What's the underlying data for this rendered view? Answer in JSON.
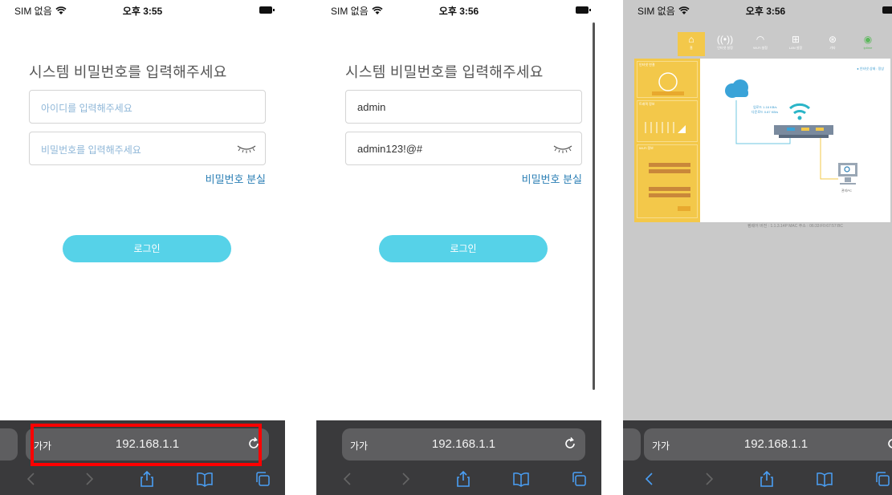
{
  "screens": [
    {
      "status": {
        "carrier": "SIM 없음",
        "time": "오후 3:55"
      },
      "login": {
        "title": "시스템 비밀번호를 입력해주세요",
        "id_placeholder": "아이디를 입력해주세요",
        "id_value": "",
        "pw_placeholder": "비밀번호를 입력해주세요",
        "pw_value": "",
        "forgot_label": "비밀번호 분실",
        "login_label": "로그인"
      },
      "browser": {
        "aa": "가가",
        "url": "192.168.1.1",
        "highlighted": true
      }
    },
    {
      "status": {
        "carrier": "SIM 없음",
        "time": "오후 3:56"
      },
      "login": {
        "title": "시스템 비밀번호를 입력해주세요",
        "id_placeholder": "아이디를 입력해주세요",
        "id_value": "admin",
        "pw_placeholder": "비밀번호를 입력해주세요",
        "pw_value": "admin123!@#",
        "forgot_label": "비밀번호 분실",
        "login_label": "로그인"
      },
      "browser": {
        "aa": "가가",
        "url": "192.168.1.1",
        "highlighted": false
      }
    },
    {
      "status": {
        "carrier": "SIM 없음",
        "time": "오후 3:56"
      },
      "dashboard": {
        "connection_status": "● 인터넷 상태 : 정상",
        "firmware": "펌웨어 버전 : 1.1.3.14P    MAC 주소 : 06:33:F0:67:57:BC",
        "nav": [
          "홈",
          "인터넷 설정",
          "Wi-Fi 설정",
          "LAN 설정",
          "기타",
          "iptime"
        ],
        "side_headers": [
          "인터넷 연결",
          "트래픽 정보",
          "Wi-Fi 정보"
        ],
        "up_speed": "업로드 1.16 KB/s",
        "down_speed": "다운로드 0.87 KB/s",
        "pc_label": "관리PC"
      },
      "browser": {
        "aa": "가가",
        "url": "192.168.1.1",
        "highlighted": false
      }
    }
  ],
  "colors": {
    "accent": "#56d2e8",
    "link": "#2b7fb5",
    "placeholder": "#8fb7d8",
    "toolbar": "#3a3a3c",
    "highlight": "#ff0000",
    "router_yellow": "#f3c84a"
  },
  "icons": [
    "wifi-icon",
    "battery-icon",
    "eye-closed-icon",
    "reload-icon",
    "back-icon",
    "forward-icon",
    "share-icon",
    "bookmarks-icon",
    "tabs-icon"
  ]
}
